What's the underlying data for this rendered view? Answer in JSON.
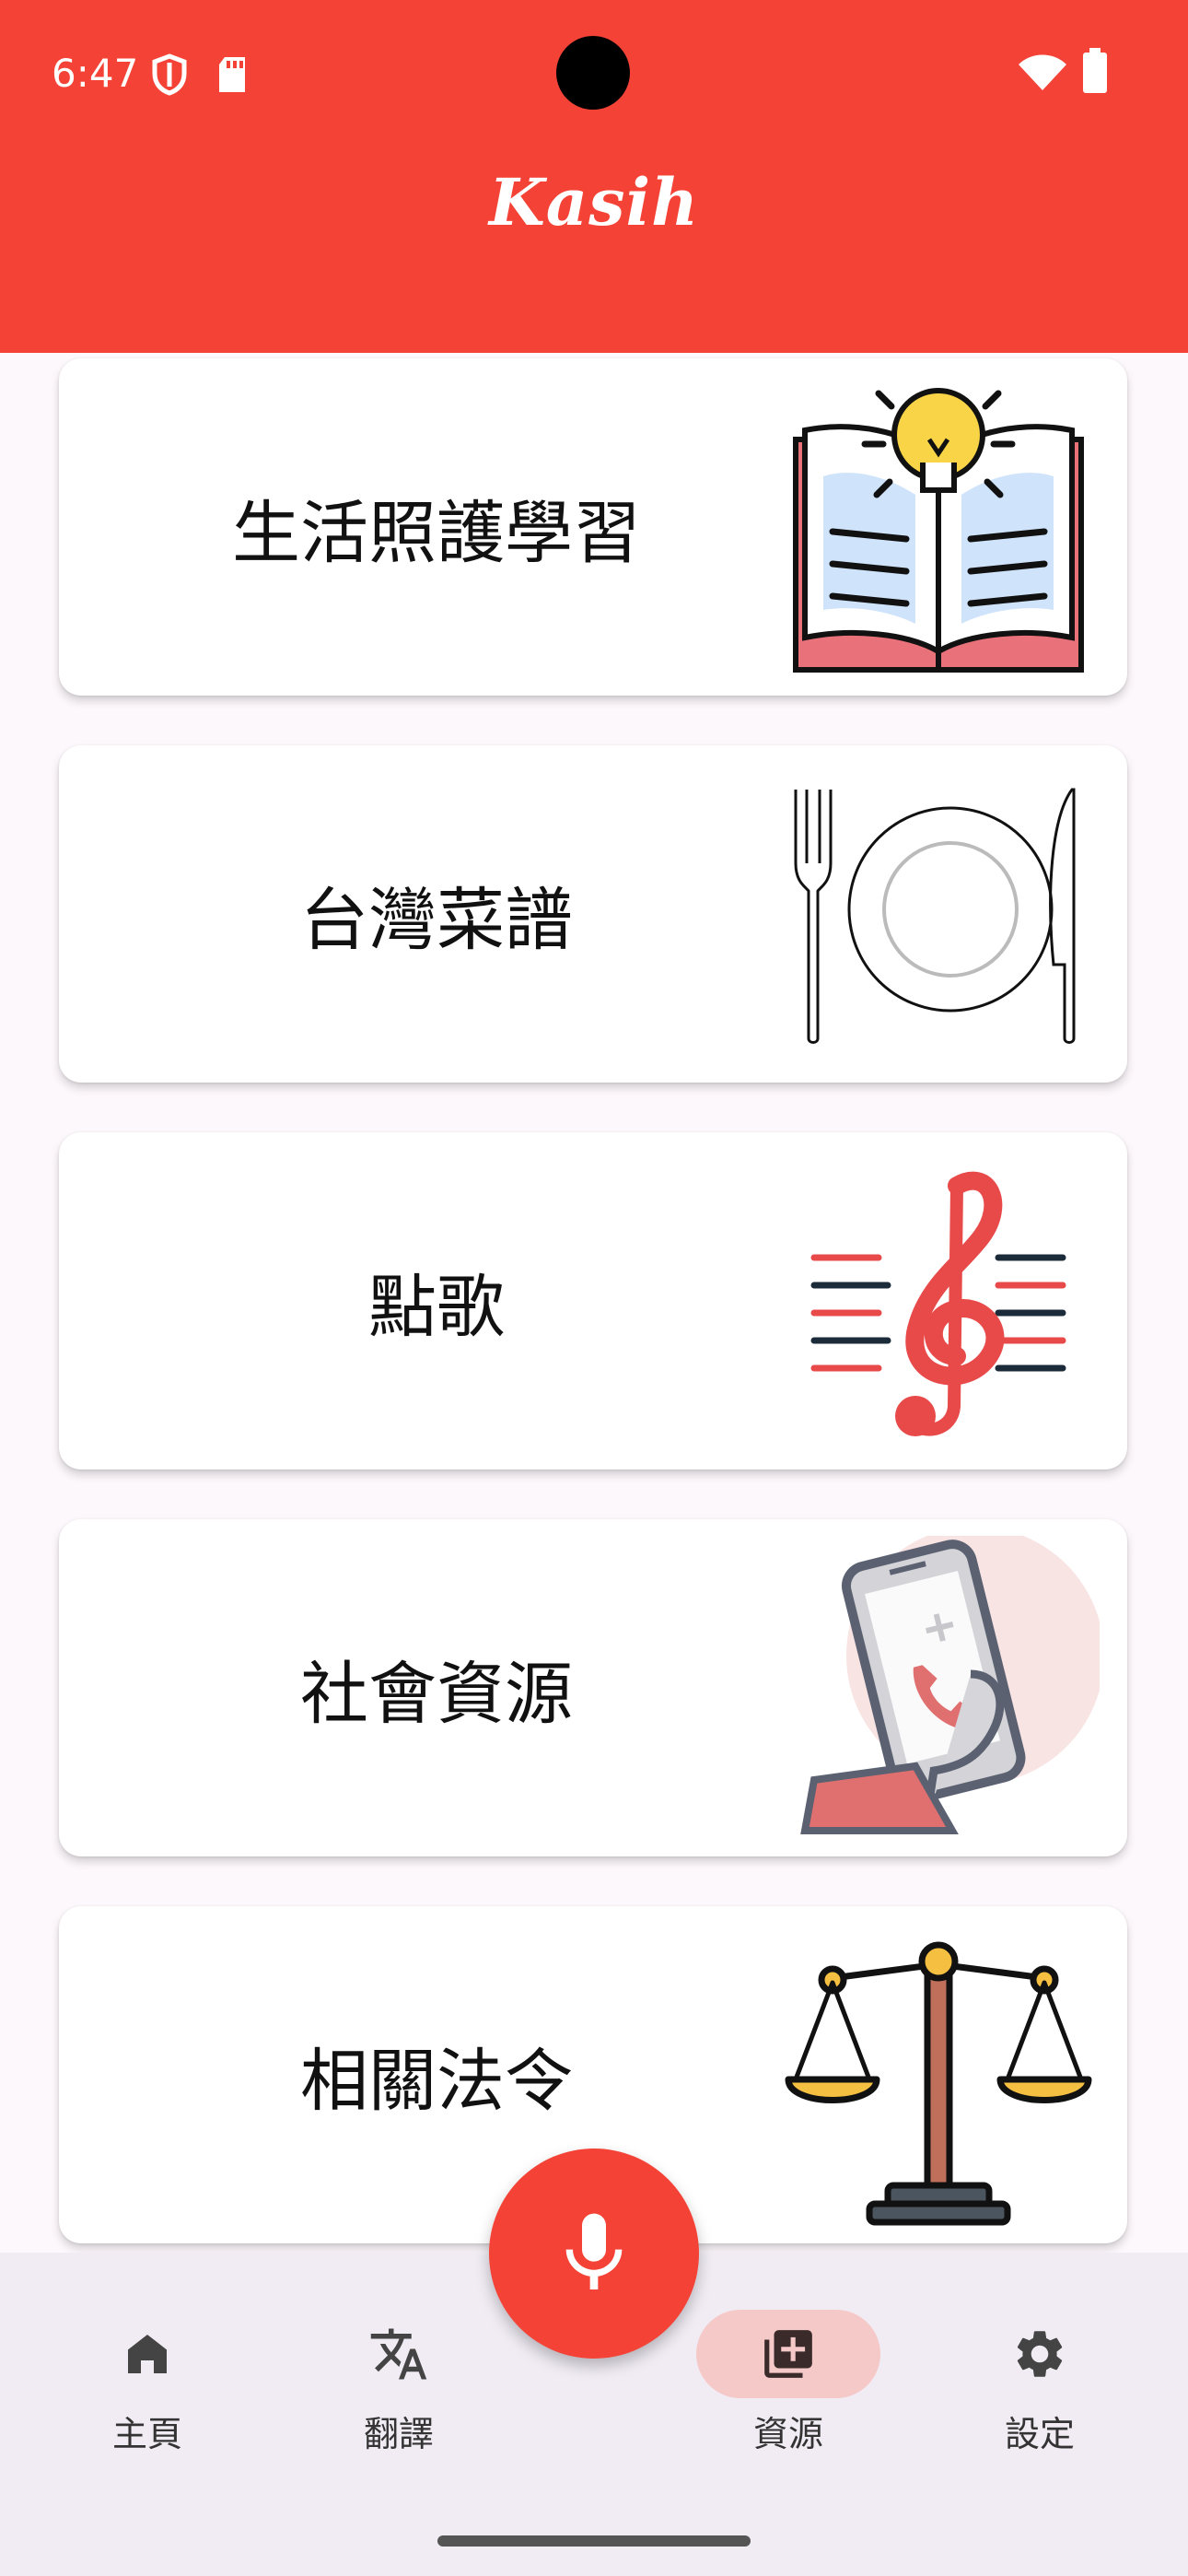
{
  "status_bar": {
    "time": "6:47",
    "icons": [
      "shield-icon",
      "sd-card-icon",
      "wifi-icon",
      "battery-icon"
    ]
  },
  "app": {
    "title": "Kasih",
    "accent_color": "#f44336"
  },
  "cards": [
    {
      "label": "生活照護學習",
      "icon": "book-lightbulb-icon"
    },
    {
      "label": "台灣菜譜",
      "icon": "plate-cutlery-icon"
    },
    {
      "label": "點歌",
      "icon": "music-note-icon"
    },
    {
      "label": "社會資源",
      "icon": "phone-call-icon"
    },
    {
      "label": "相關法令",
      "icon": "scales-icon"
    }
  ],
  "bottom_nav": {
    "items": [
      {
        "label": "主頁",
        "icon": "home-icon",
        "active": false
      },
      {
        "label": "翻譯",
        "icon": "translate-icon",
        "active": false
      },
      {
        "label": "資源",
        "icon": "library-add-icon",
        "active": true
      },
      {
        "label": "設定",
        "icon": "gear-icon",
        "active": false
      }
    ],
    "fab_icon": "microphone-icon"
  }
}
